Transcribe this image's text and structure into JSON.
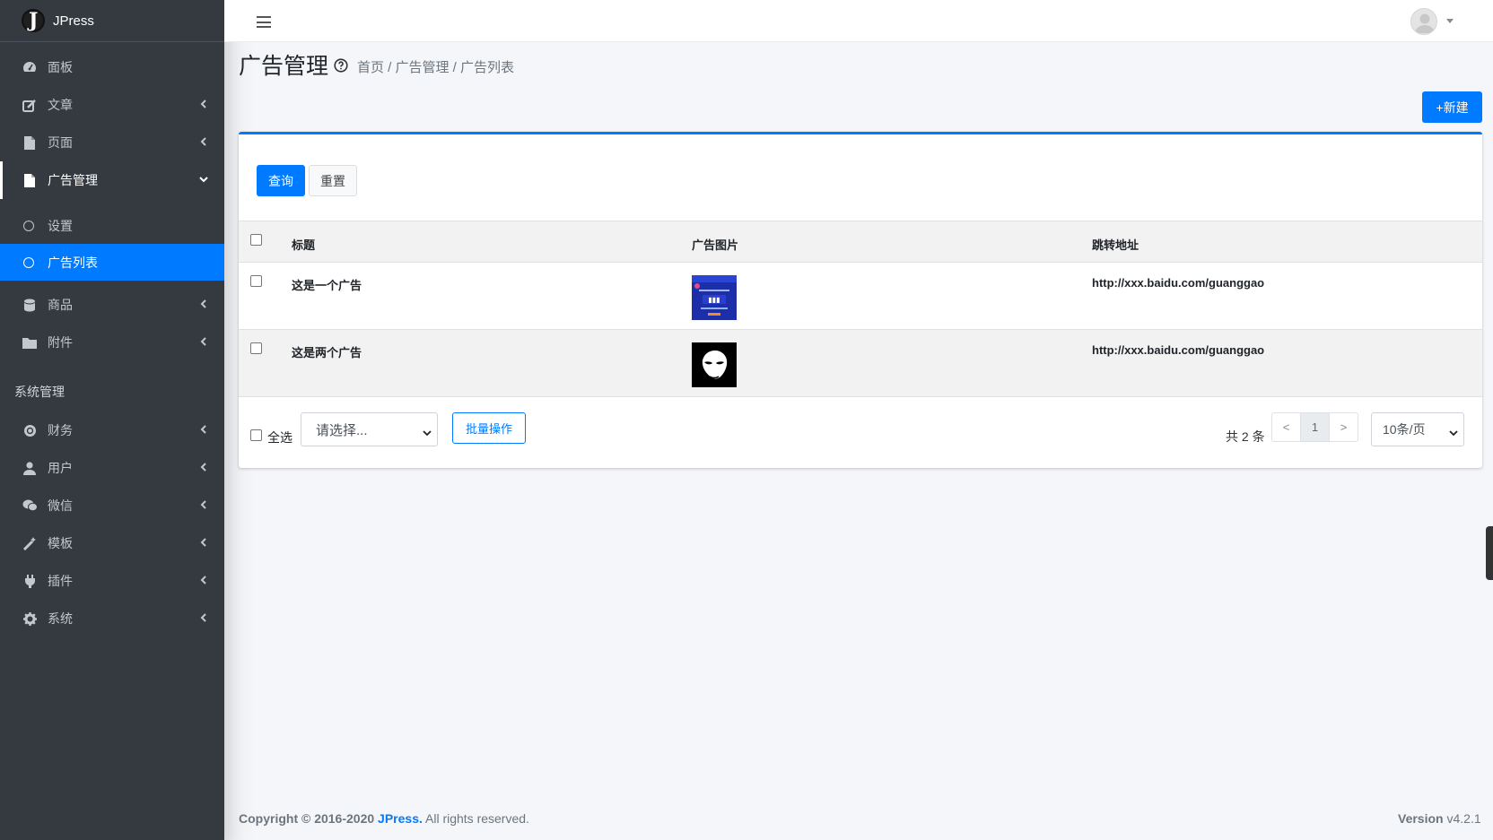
{
  "brand": {
    "name": "JPress",
    "logo_letter": "J"
  },
  "sidebar": {
    "items": [
      {
        "label": "面板",
        "icon": "dashboard-icon",
        "has_chevron": false
      },
      {
        "label": "文章",
        "icon": "edit-icon",
        "has_chevron": true
      },
      {
        "label": "页面",
        "icon": "file-icon",
        "has_chevron": true
      },
      {
        "label": "广告管理",
        "icon": "file-icon",
        "has_chevron": true,
        "open": true
      }
    ],
    "sub_items": [
      {
        "label": "设置",
        "active": false
      },
      {
        "label": "广告列表",
        "active": true
      }
    ],
    "items_after": [
      {
        "label": "商品",
        "icon": "database-icon"
      },
      {
        "label": "附件",
        "icon": "folder-icon"
      }
    ],
    "system_header": "系统管理",
    "system_items": [
      {
        "label": "财务",
        "icon": "coin-icon"
      },
      {
        "label": "用户",
        "icon": "user-icon"
      },
      {
        "label": "微信",
        "icon": "wechat-icon"
      },
      {
        "label": "模板",
        "icon": "magic-icon"
      },
      {
        "label": "插件",
        "icon": "plug-icon"
      },
      {
        "label": "系统",
        "icon": "gear-icon"
      }
    ]
  },
  "header": {
    "page_title": "广告管理",
    "breadcrumb": "首页 / 广告管理 / 广告列表",
    "new_button": "+新建"
  },
  "filters": {
    "query": "查询",
    "reset": "重置"
  },
  "table": {
    "columns": [
      "标题",
      "广告图片",
      "跳转地址"
    ],
    "rows": [
      {
        "title": "这是一个广告",
        "url": "http://xxx.baidu.com/guanggao",
        "image": "poster-image"
      },
      {
        "title": "这是两个广告",
        "url": "http://xxx.baidu.com/guanggao",
        "image": "mask-image"
      }
    ]
  },
  "footer_bar": {
    "select_all": "全选",
    "batch_select_placeholder": "请选择...",
    "batch_button": "批量操作",
    "total": "共 2 条",
    "pager": [
      "<",
      "1",
      ">"
    ],
    "page_size": "10条/页"
  },
  "page_footer": {
    "copyright_prefix": "Copyright © 2016-2020 ",
    "brand": "JPress.",
    "suffix": " All rights reserved.",
    "version_label": "Version",
    "version": " v4.2.1"
  },
  "colors": {
    "primary": "#007bff",
    "sidebar": "#343a40"
  }
}
